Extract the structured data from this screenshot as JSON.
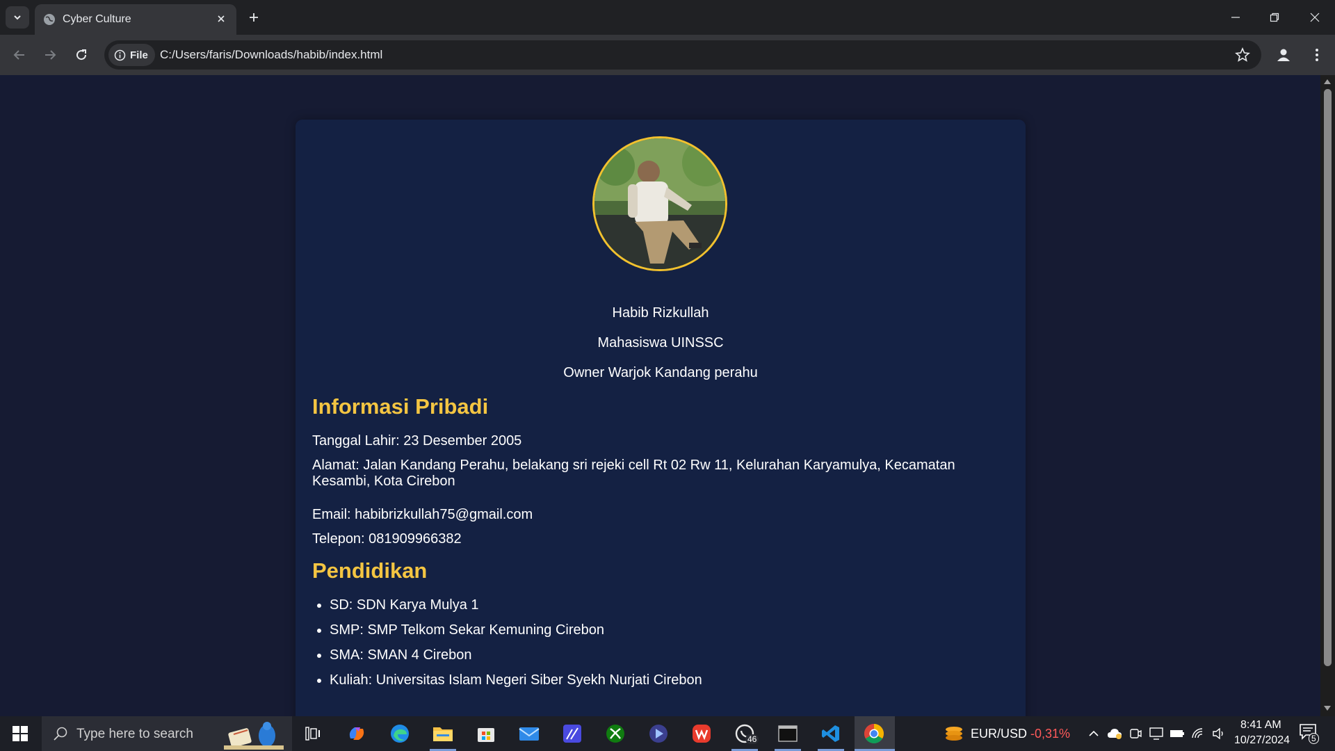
{
  "browser": {
    "tab_title": "Cyber Culture",
    "security_chip": "File",
    "url": "C:/Users/faris/Downloads/habib/index.html"
  },
  "profile": {
    "name": "Habib Rizkullah",
    "line2": "Mahasiswa UINSSC",
    "line3": "Owner Warjok Kandang perahu"
  },
  "personal_info": {
    "heading": "Informasi Pribadi",
    "birth": "Tanggal Lahir: 23 Desember 2005",
    "address": "Alamat: Jalan Kandang Perahu, belakang sri rejeki cell Rt 02 Rw 11, Kelurahan Karyamulya, Kecamatan Kesambi, Kota Cirebon",
    "email": "Email: habibrizkullah75@gmail.com",
    "phone": "Telepon: 081909966382"
  },
  "education": {
    "heading": "Pendidikan",
    "items": [
      "SD: SDN Karya Mulya 1",
      "SMP: SMP Telkom Sekar Kemuning Cirebon",
      "SMA: SMAN 4 Cirebon",
      "Kuliah: Universitas Islam Negeri Siber Syekh Nurjati Cirebon"
    ]
  },
  "taskbar": {
    "search_placeholder": "Type here to search",
    "whatsapp_badge": "46",
    "ticker_label": "EUR/USD",
    "ticker_change": "-0,31%",
    "time": "8:41 AM",
    "date": "10/27/2024",
    "notification_count": "5"
  },
  "colors": {
    "page_bg": "#161b33",
    "card_bg": "#142143",
    "heading_accent": "#f4c542",
    "avatar_border": "#f2c12e",
    "ticker_negative": "#ff5a5a"
  }
}
